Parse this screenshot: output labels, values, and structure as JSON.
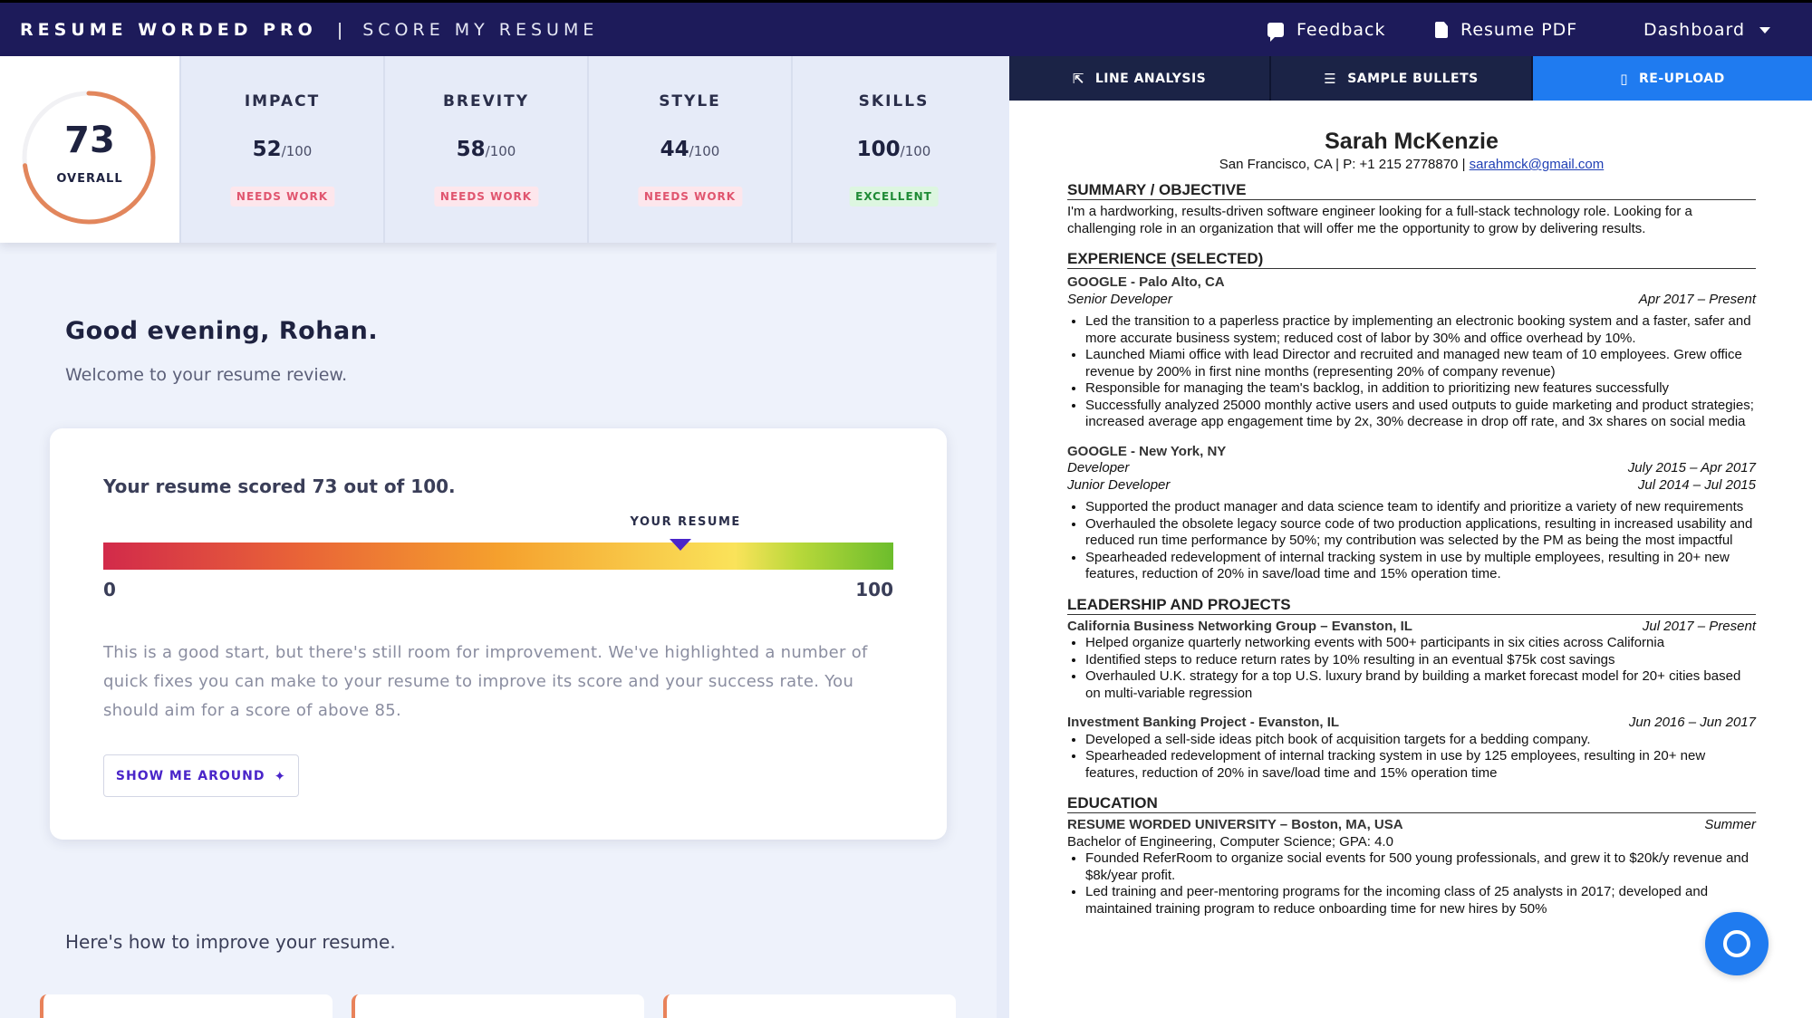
{
  "topbar": {
    "brand": "RESUME WORDED PRO",
    "separator": "|",
    "section": "SCORE MY RESUME",
    "feedback": "Feedback",
    "resume_pdf": "Resume PDF",
    "dashboard": "Dashboard"
  },
  "score": {
    "overall_value": "73",
    "overall_label": "OVERALL",
    "overall_fraction": 0.73,
    "metrics": [
      {
        "name": "IMPACT",
        "score": "52",
        "out_of": "/100",
        "badge": "NEEDS WORK"
      },
      {
        "name": "BREVITY",
        "score": "58",
        "out_of": "/100",
        "badge": "NEEDS WORK"
      },
      {
        "name": "STYLE",
        "score": "44",
        "out_of": "/100",
        "badge": "NEEDS WORK"
      },
      {
        "name": "SKILLS",
        "score": "100",
        "out_of": "/100",
        "badge": "EXCELLENT"
      }
    ]
  },
  "main": {
    "greeting": "Good evening, Rohan.",
    "welcome": "Welcome to your resume review.",
    "card": {
      "title": "Your resume scored 73 out of 100.",
      "marker_label": "YOUR RESUME",
      "marker_value": 73,
      "min": "0",
      "max": "100",
      "body": "This is a good start, but there's still room for improvement. We've highlighted a number of quick fixes you can make to your resume to improve its score and your success rate. You should aim for a score of above 85.",
      "button": "SHOW ME AROUND"
    },
    "improve_heading": "Here's how to improve your resume."
  },
  "tabs": {
    "line_analysis": "LINE ANALYSIS",
    "sample_bullets": "SAMPLE BULLETS",
    "reupload": "RE-UPLOAD"
  },
  "resume": {
    "name": "Sarah McKenzie",
    "contact_prefix": "San Francisco, CA | P: +1 215 2778870 | ",
    "email": "sarahmck@gmail.com",
    "summary_heading": "SUMMARY / OBJECTIVE",
    "summary": "I'm a hardworking, results-driven software engineer looking for a full-stack technology role. Looking for a challenging role in an organization that will offer me the opportunity to grow by delivering results.",
    "experience_heading": "EXPERIENCE (SELECTED)",
    "job1": {
      "org": "GOOGLE - Palo Alto, CA",
      "title": "Senior Developer",
      "dates": "Apr 2017 – Present",
      "bullets": [
        "Led the transition to a paperless practice by implementing an electronic booking system and a faster, safer and more accurate business system; reduced cost of labor by 30% and office overhead by 10%.",
        "Launched Miami office with lead Director and recruited and managed new team of 10 employees. Grew office revenue by 200% in first nine months (representing 20% of company revenue)",
        "Responsible for managing the team's backlog, in addition to prioritizing new features successfully",
        "Successfully analyzed 25000 monthly active users and used outputs to guide marketing and product strategies; increased average app engagement time by 2x, 30% decrease in drop off rate, and 3x shares on social media"
      ]
    },
    "job2": {
      "org": "GOOGLE - New York, NY",
      "title1": "Developer",
      "dates1": "July 2015 – Apr 2017",
      "title2": "Junior Developer",
      "dates2": "Jul 2014 – Jul 2015",
      "bullets": [
        "Supported the product manager and data science team to identify and prioritize a variety of new requirements",
        "Overhauled the obsolete legacy source code of two production applications, resulting in increased usability and reduced run time performance by 50%; my contribution was selected by the PM as being the most impactful",
        "Spearheaded redevelopment of internal tracking system in use by multiple employees, resulting in 20+ new features, reduction of 20% in save/load time and 15% operation time."
      ]
    },
    "leadership_heading": "LEADERSHIP AND PROJECTS",
    "proj1": {
      "org": "California Business Networking Group – Evanston, IL",
      "dates": "Jul 2017 – Present",
      "bullets": [
        "Helped organize quarterly networking events with 500+ participants in six cities across California",
        "Identified steps to reduce return rates by 10% resulting in an eventual $75k cost savings",
        "Overhauled U.K. strategy for a top U.S. luxury brand by building a market forecast model for 20+ cities based on multi-variable regression"
      ]
    },
    "proj2": {
      "org": "Investment Banking Project - Evanston, IL",
      "dates": "Jun 2016 – Jun 2017",
      "bullets": [
        "Developed a sell-side ideas pitch book of acquisition targets for a bedding company.",
        "Spearheaded redevelopment of internal tracking system in use by 125 employees, resulting in 20+ new features, reduction of 20% in save/load time and 15% operation time"
      ]
    },
    "education_heading": "EDUCATION",
    "edu": {
      "org": "RESUME WORDED UNIVERSITY – Boston, MA, USA",
      "dates": "Summer",
      "degree": "Bachelor of Engineering, Computer Science; GPA: 4.0",
      "bullets": [
        "Founded ReferRoom to organize social events for 500 young professionals, and grew it to $20k/y revenue and $8k/year profit.",
        "Led training and peer-mentoring programs for the incoming class of 25 analysts in 2017; developed and maintained training program to reduce onboarding time for new hires by 50%"
      ]
    }
  },
  "icons": {
    "feedback": "chat-bubble-icon",
    "pdf": "file-pdf-icon",
    "dashboard": "chevron-down-icon",
    "line_analysis": "upload-lines-icon",
    "sample_bullets": "list-icon",
    "reupload": "file-icon",
    "show_me_around": "magic-wand-icon",
    "support": "chat-support-icon"
  },
  "colors": {
    "accent": "#4a25c9",
    "topbar": "#1d1b5a",
    "active_tab": "#1f7bf0",
    "needs_work": "#e0556f",
    "excellent": "#1e8a35",
    "score_ring": "#e2865c"
  }
}
